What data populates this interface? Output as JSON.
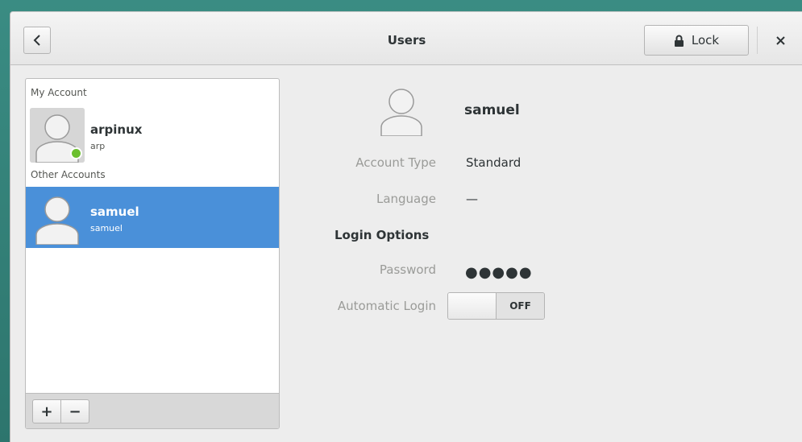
{
  "header": {
    "title": "Users",
    "lock_label": "Lock"
  },
  "sidebar": {
    "my_account_label": "My Account",
    "other_accounts_label": "Other Accounts",
    "my_account": {
      "name": "arpinux",
      "username": "arp",
      "online": true
    },
    "other_accounts": [
      {
        "name": "samuel",
        "username": "samuel",
        "selected": true
      }
    ],
    "add_label": "+",
    "remove_label": "−"
  },
  "details": {
    "name": "samuel",
    "account_type_label": "Account Type",
    "account_type_value": "Standard",
    "language_label": "Language",
    "language_value": "—",
    "login_options_heading": "Login Options",
    "password_label": "Password",
    "password_value": "●●●●●",
    "automatic_login_label": "Automatic Login",
    "automatic_login_state": "OFF"
  },
  "icons": {
    "back": "chevron-left-icon",
    "lock": "lock-icon",
    "close": "close-icon",
    "avatar": "user-avatar-icon"
  },
  "colors": {
    "accent": "#4a90d9",
    "online": "#6cc02f",
    "desktop": "#2f7a72"
  }
}
